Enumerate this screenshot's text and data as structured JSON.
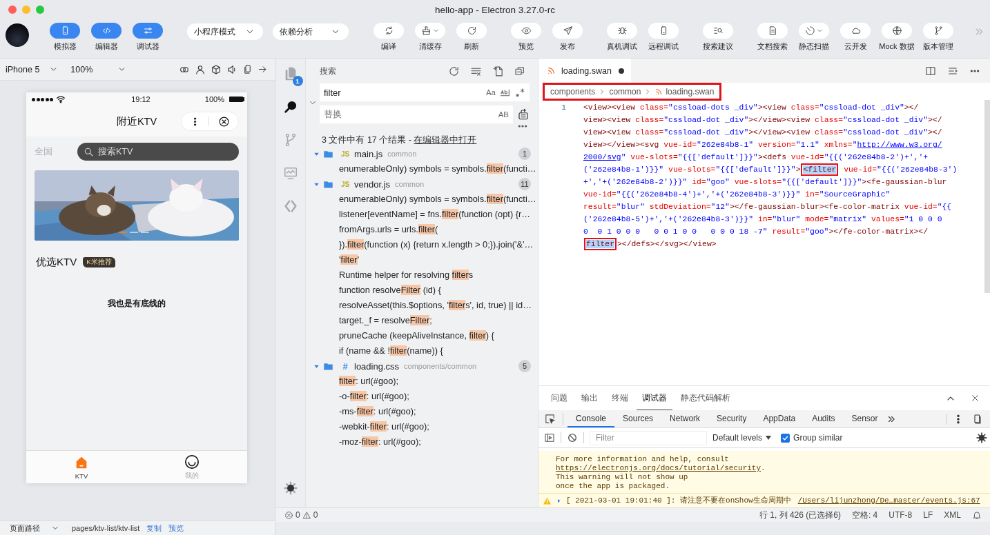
{
  "window": {
    "title": "hello-app - Electron 3.27.0-rc"
  },
  "toolbar": {
    "views": [
      {
        "label": "模拟器",
        "on": true
      },
      {
        "label": "编辑器",
        "on": true
      },
      {
        "label": "调试器",
        "on": true
      }
    ],
    "dropdowns": [
      {
        "value": "小程序模式"
      },
      {
        "value": "依赖分析"
      }
    ],
    "tool_groups": [
      {
        "tools": [
          {
            "label": "编译",
            "caret": false
          },
          {
            "label": "清缓存",
            "caret": true
          },
          {
            "label": "刷新",
            "caret": false
          }
        ]
      },
      {
        "tools": [
          {
            "label": "预览",
            "caret": false
          },
          {
            "label": "发布",
            "caret": false
          }
        ]
      },
      {
        "tools": [
          {
            "label": "真机调试",
            "caret": false
          },
          {
            "label": "远程调试",
            "caret": false
          }
        ]
      },
      {
        "tools": [
          {
            "label": "搜索建议",
            "caret": false
          }
        ]
      },
      {
        "tools": [
          {
            "label": "文档搜索",
            "caret": false
          },
          {
            "label": "静态扫描",
            "caret": true
          },
          {
            "label": "云开发",
            "caret": false
          },
          {
            "label": "Mock 数据",
            "caret": false
          },
          {
            "label": "版本管理",
            "caret": false
          }
        ]
      }
    ]
  },
  "simulator": {
    "device": "iPhone 5",
    "zoom": "100%",
    "phone": {
      "time": "19:12",
      "battery": "100%",
      "nav_title": "附近KTV",
      "region": "全国",
      "search_placeholder": "搜索KTV",
      "banner": {
        "kind": "picture",
        "dots": [
          {
            "selected": true
          },
          {
            "selected": false
          },
          {
            "selected": false
          }
        ]
      },
      "section_title": "优选KTV",
      "badge": "K米推荐",
      "footer_note": "我也是有底线的",
      "tabs": [
        {
          "label": "KTV",
          "selected": true
        },
        {
          "label": "我的",
          "selected": false
        }
      ]
    },
    "page_path": {
      "label": "页面路径",
      "path": "pages/ktv-list/ktv-list",
      "actions": [
        "复制",
        "预览"
      ]
    }
  },
  "activity_bar": {
    "items": [
      {
        "selected": false,
        "badge": "1"
      },
      {
        "selected": true
      },
      {
        "selected": false
      },
      {
        "selected": false
      },
      {
        "selected": false
      }
    ]
  },
  "search": {
    "title": "搜索",
    "query": "filter",
    "case_toggle": "Aa",
    "replace_placeholder": "替换",
    "preserve_case": "AB",
    "expanded": true,
    "summary": "3 文件中有 17 个结果 - ",
    "open_link": "在编辑器中打开",
    "files": [
      {
        "kind": "js",
        "type_label": "JS",
        "name": "main.js",
        "path": "common",
        "count": "1",
        "expanded": true,
        "matches": [
          "enumerableOnly) symbols = symbols.**filter**(functi…"
        ]
      },
      {
        "kind": "js",
        "type_label": "JS",
        "name": "vendor.js",
        "path": "common",
        "count": "11",
        "expanded": true,
        "matches": [
          "enumerableOnly) symbols = symbols.**filter**(functi…",
          "listener[eventName] = fns.**filter**(function (opt) {r…",
          "fromArgs.urls = urls.**filter**(",
          "}).**filter**(function (x) {return x.length > 0;}).join('&'…",
          "'**filter**'",
          "Runtime helper for resolving **filter**s",
          "function resolve**Filter** (id) {",
          "resolveAsset(this.$options, '**filter**s', id, true) || id…",
          "target._f = resolve**Filter**;",
          "pruneCache (keepAliveInstance, **filter**) {",
          "if (name && !**filter**(name)) {"
        ]
      },
      {
        "kind": "css",
        "type_label": "#",
        "name": "loading.css",
        "path": "components/common",
        "count": "5",
        "expanded": true,
        "matches": [
          "**filter**: url(#goo);",
          "-o-**filter**: url(#goo);",
          "-ms-**filter**: url(#goo);",
          "-webkit-**filter**: url(#goo);",
          "-moz-**filter**: url(#goo);"
        ]
      }
    ]
  },
  "editor": {
    "tab": {
      "name": "loading.swan",
      "modified": true
    },
    "breadcrumb": {
      "items": [
        "components",
        "common",
        "loading.swan"
      ],
      "annotated": true
    },
    "line_number": "1",
    "lines": [
      [
        {
          "kind": "tag",
          "text": "<view><view "
        },
        {
          "kind": "attr",
          "text": "class="
        },
        {
          "kind": "value",
          "text": "\"cssload-dots _div\""
        },
        {
          "kind": "tag",
          "text": "><view "
        },
        {
          "kind": "attr",
          "text": "class="
        },
        {
          "kind": "value",
          "text": "\"cssload-dot _div\""
        },
        {
          "kind": "tag",
          "text": "></"
        }
      ],
      [
        {
          "kind": "tag",
          "text": "view><view "
        },
        {
          "kind": "attr",
          "text": "class="
        },
        {
          "kind": "value",
          "text": "\"cssload-dot _div\""
        },
        {
          "kind": "tag",
          "text": "></view><view "
        },
        {
          "kind": "attr",
          "text": "class="
        },
        {
          "kind": "value",
          "text": "\"cssload-dot _div\""
        },
        {
          "kind": "tag",
          "text": "></"
        }
      ],
      [
        {
          "kind": "tag",
          "text": "view><view "
        },
        {
          "kind": "attr",
          "text": "class="
        },
        {
          "kind": "value",
          "text": "\"cssload-dot _div\""
        },
        {
          "kind": "tag",
          "text": "></view><view "
        },
        {
          "kind": "attr",
          "text": "class="
        },
        {
          "kind": "value",
          "text": "\"cssload-dot _div\""
        },
        {
          "kind": "tag",
          "text": "></"
        }
      ],
      [
        {
          "kind": "tag",
          "text": "view></view><svg "
        },
        {
          "kind": "attr",
          "text": "vue-id="
        },
        {
          "kind": "value",
          "text": "\"262e84b8-1\""
        },
        {
          "kind": "attr",
          "text": " version="
        },
        {
          "kind": "value",
          "text": "\"1.1\""
        },
        {
          "kind": "attr",
          "text": " xmlns="
        },
        {
          "kind": "value",
          "text": "\""
        },
        {
          "kind": "link",
          "text": "http://www.w3.org/"
        }
      ],
      [
        {
          "kind": "link",
          "text": "2000/svg"
        },
        {
          "kind": "value",
          "text": "\""
        },
        {
          "kind": "attr",
          "text": " vue-slots="
        },
        {
          "kind": "value",
          "text": "\"{{['default']}}\""
        },
        {
          "kind": "tag",
          "text": "><defs "
        },
        {
          "kind": "attr",
          "text": "vue-id="
        },
        {
          "kind": "value",
          "text": "\"{{('262e84b8-2')+','+"
        }
      ],
      [
        {
          "kind": "value",
          "text": "('262e84b8-1')}}\""
        },
        {
          "kind": "attr",
          "text": " vue-slots="
        },
        {
          "kind": "value",
          "text": "\"{{['default']}}\""
        },
        {
          "kind": "tag",
          "text": ">"
        },
        {
          "kind": "match",
          "text": "<filter"
        },
        {
          "kind": "attr",
          "text": " vue-id="
        },
        {
          "kind": "value",
          "text": "\"{{('262e84b8-3')"
        }
      ],
      [
        {
          "kind": "value",
          "text": "+','+('262e84b8-2')}}\""
        },
        {
          "kind": "attr",
          "text": " id="
        },
        {
          "kind": "value",
          "text": "\"goo\""
        },
        {
          "kind": "attr",
          "text": " vue-slots="
        },
        {
          "kind": "value",
          "text": "\"{{['default']}}\""
        },
        {
          "kind": "tag",
          "text": "><fe-gaussian-blur"
        }
      ],
      [
        {
          "kind": "attr",
          "text": "vue-id="
        },
        {
          "kind": "value",
          "text": "\"{{('262e84b8-4')+','+('262e84b8-3')}}\""
        },
        {
          "kind": "attr",
          "text": " in="
        },
        {
          "kind": "value",
          "text": "\"SourceGraphic\""
        }
      ],
      [
        {
          "kind": "attr",
          "text": "result="
        },
        {
          "kind": "value",
          "text": "\"blur\""
        },
        {
          "kind": "attr",
          "text": " stdDeviation="
        },
        {
          "kind": "value",
          "text": "\"12\""
        },
        {
          "kind": "tag",
          "text": "></fe-gaussian-blur><fe-color-matrix "
        },
        {
          "kind": "attr",
          "text": "vue-id="
        },
        {
          "kind": "value",
          "text": "\"{{"
        }
      ],
      [
        {
          "kind": "value",
          "text": "('262e84b8-5')+','+('262e84b8-3')}}\""
        },
        {
          "kind": "attr",
          "text": " in="
        },
        {
          "kind": "value",
          "text": "\"blur\""
        },
        {
          "kind": "attr",
          "text": " mode="
        },
        {
          "kind": "value",
          "text": "\"matrix\""
        },
        {
          "kind": "attr",
          "text": " values="
        },
        {
          "kind": "value",
          "text": "\"1 0 0 0"
        }
      ],
      [
        {
          "kind": "value",
          "text": "0  0 1 0 0 0   0 0 1 0 0   0 0 0 18 -7\""
        },
        {
          "kind": "attr",
          "text": " result="
        },
        {
          "kind": "value",
          "text": "\"goo\""
        },
        {
          "kind": "tag",
          "text": "></fe-color-matrix></"
        }
      ],
      [
        {
          "kind": "match",
          "text": "filter"
        },
        {
          "kind": "tag",
          "text": "></defs></svg></view>"
        }
      ]
    ]
  },
  "panel": {
    "tabs": [
      {
        "label": "问题",
        "selected": false
      },
      {
        "label": "输出",
        "selected": false
      },
      {
        "label": "终端",
        "selected": false
      },
      {
        "label": "调试器",
        "selected": true
      },
      {
        "label": "静态代码解析",
        "selected": false
      }
    ],
    "devtools": {
      "tabs": [
        {
          "label": "Console",
          "selected": true
        },
        {
          "label": "Sources",
          "selected": false
        },
        {
          "label": "Network",
          "selected": false
        },
        {
          "label": "Security",
          "selected": false
        },
        {
          "label": "AppData",
          "selected": false
        },
        {
          "label": "Audits",
          "selected": false
        },
        {
          "label": "Sensor",
          "selected": false
        }
      ],
      "filter_placeholder": "Filter",
      "levels": "Default levels",
      "group_similar": {
        "label": "Group similar",
        "checked": true
      },
      "messages": [
        {
          "kind": "continued",
          "lines": [
            {
              "text": "For more information and help, consult"
            },
            {
              "link": "https://electronjs.org/docs/tutorial/security",
              "text": "."
            },
            {
              "text": "This warning will not show up"
            },
            {
              "text": "once the app is packaged."
            }
          ]
        },
        {
          "kind": "warning",
          "text": "[ 2021-03-01 19:01:40 ]: 请注意不要在onShow生命周期中",
          "source": "/Users/lijunzhong/De…master/events.js:67"
        }
      ]
    }
  },
  "status_bar": {
    "errors": "0",
    "warnings": "0",
    "cursor": "行 1, 列 426 (已选择6)",
    "indent": "空格: 4",
    "encoding": "UTF-8",
    "eol": "LF",
    "language": "XML"
  }
}
